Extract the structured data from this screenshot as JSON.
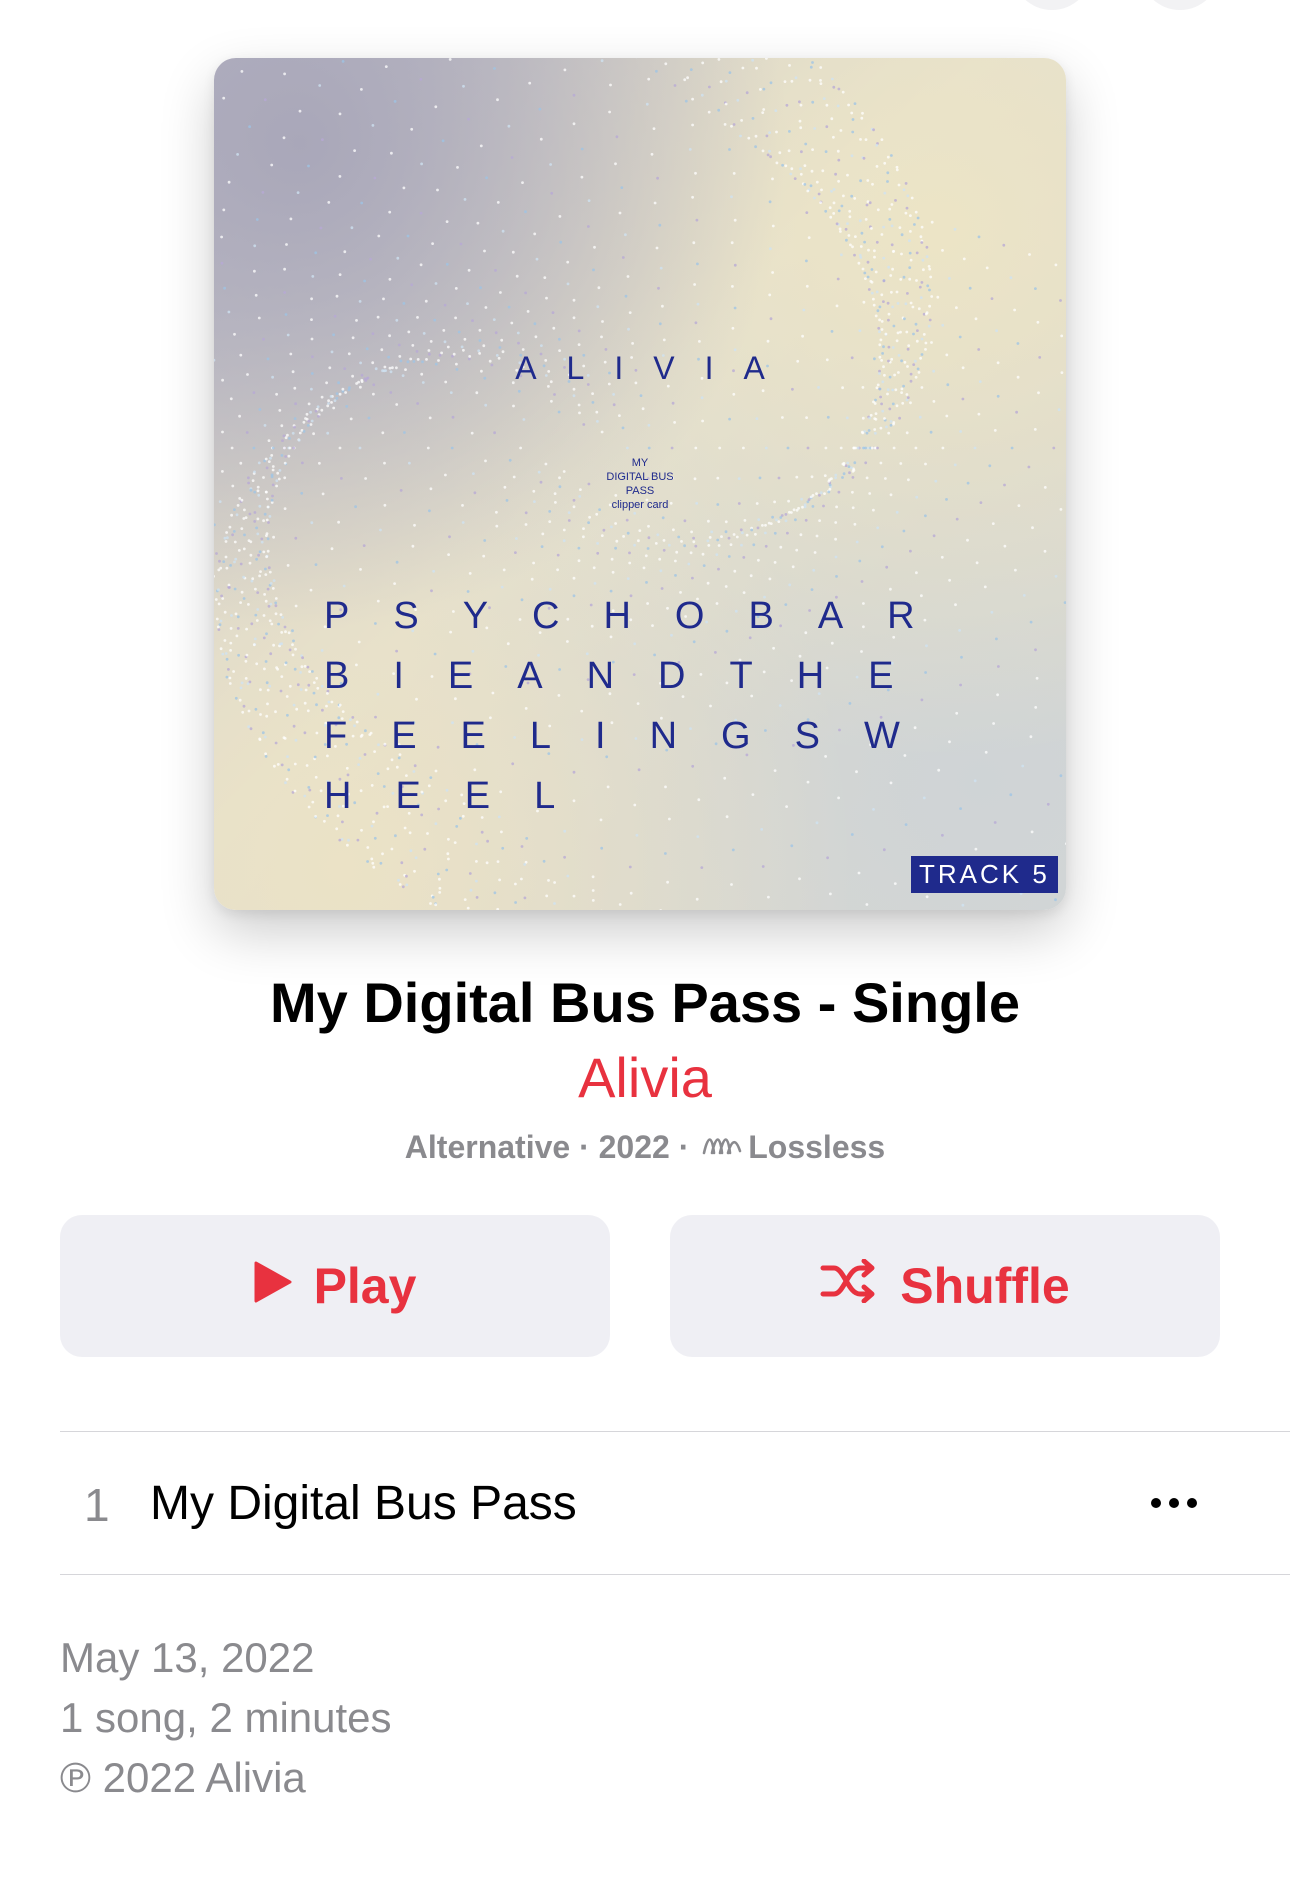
{
  "album": {
    "artwork": {
      "artist_text": "ALIVIA",
      "small_text": [
        "MY",
        "DIGITAL BUS",
        "PASS",
        "clipper card"
      ],
      "title_lines": [
        "PSYCHOBAR",
        "BIEANDTHE",
        "FEELINGSW",
        "HEEL"
      ],
      "track_badge": "TRACK 5"
    },
    "title": "My Digital Bus Pass - Single",
    "artist": "Alivia",
    "meta": {
      "genre": "Alternative",
      "year": "2022",
      "quality": "Lossless",
      "separator": " · ",
      "quality_icon": "lossless-icon"
    }
  },
  "actions": {
    "play_label": "Play",
    "play_icon": "play-icon",
    "shuffle_label": "Shuffle",
    "shuffle_icon": "shuffle-icon"
  },
  "tracks": [
    {
      "number": "1",
      "title": "My Digital Bus Pass",
      "more_icon": "more-icon"
    }
  ],
  "footer": {
    "release_date": "May 13, 2022",
    "summary": "1 song, 2 minutes",
    "copyright": "℗ 2022 Alivia"
  },
  "colors": {
    "accent": "#e8323f",
    "secondary_text": "#8a8a8e",
    "button_bg": "#efeff4",
    "artwork_text": "#1f2a8c"
  }
}
